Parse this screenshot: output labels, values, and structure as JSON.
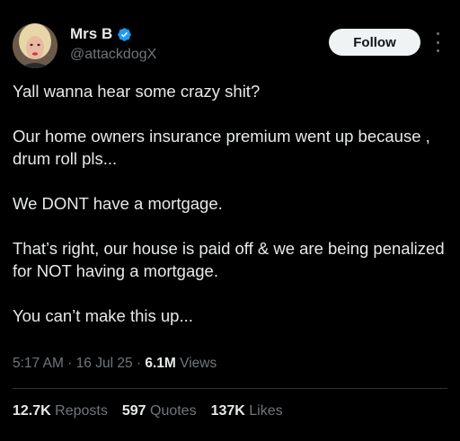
{
  "author": {
    "display_name": "Mrs B",
    "handle": "@attackdogX",
    "verified_icon": "verified-badge-icon",
    "verified_color": "#1d9bf0"
  },
  "actions": {
    "follow_label": "Follow",
    "more_icon": "more-options-icon"
  },
  "tweet": {
    "paragraphs": [
      "Yall wanna hear some crazy shit?",
      "Our home owners insurance premium went up because , drum roll pls...",
      "We DONT have a mortgage.",
      "That’s right, our house is paid off & we are being penalized for NOT having a mortgage.",
      "You can’t make this up..."
    ]
  },
  "meta": {
    "time": "5:17 AM",
    "separator": " · ",
    "date": "16 Jul 25",
    "views_count": "6.1M",
    "views_label": " Views"
  },
  "stats": {
    "reposts_count": "12.7K",
    "reposts_label": " Reposts",
    "quotes_count": "597",
    "quotes_label": " Quotes",
    "likes_count": "137K",
    "likes_label": " Likes"
  },
  "colors": {
    "background": "#000000",
    "text_primary": "#e7e9ea",
    "text_secondary": "#71767b",
    "divider": "#2f3336",
    "follow_bg": "#eff3f4"
  }
}
